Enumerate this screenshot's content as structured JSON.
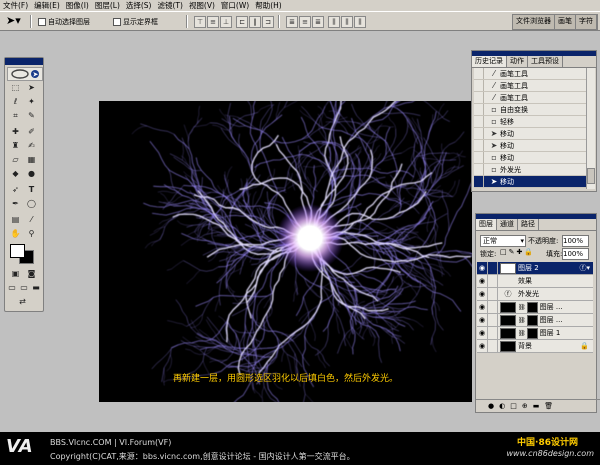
{
  "menu": [
    "文件(F)",
    "编辑(E)",
    "图像(I)",
    "图层(L)",
    "选择(S)",
    "滤镜(T)",
    "视图(V)",
    "窗口(W)",
    "帮助(H)"
  ],
  "options": {
    "auto_select": "自动选择图层",
    "show_bbox": "显示定界框"
  },
  "well_tabs": [
    "文件浏览器",
    "画笔",
    "字符"
  ],
  "history": {
    "tabs": [
      "历史记录",
      "动作",
      "工具预设"
    ],
    "items": [
      {
        "icon": "brush",
        "label": "画笔工具"
      },
      {
        "icon": "brush",
        "label": "画笔工具"
      },
      {
        "icon": "brush",
        "label": "画笔工具"
      },
      {
        "icon": "doc",
        "label": "自由变换"
      },
      {
        "icon": "doc",
        "label": "轻移"
      },
      {
        "icon": "move",
        "label": "移动"
      },
      {
        "icon": "move",
        "label": "移动"
      },
      {
        "icon": "doc",
        "label": "移动"
      },
      {
        "icon": "doc",
        "label": "外发光"
      },
      {
        "icon": "move",
        "label": "移动"
      }
    ]
  },
  "layers": {
    "tabs": [
      "图层",
      "通道",
      "路径"
    ],
    "blend_mode": "正常",
    "opacity_label": "不透明度:",
    "opacity": "100%",
    "lock_label": "锁定:",
    "fill_label": "填充:",
    "fill": "100%",
    "rows": [
      {
        "name": "图层 2",
        "type": "active"
      },
      {
        "name": "效果",
        "type": "effect-head"
      },
      {
        "name": "外发光",
        "type": "effect"
      },
      {
        "name": "图层 ...",
        "type": "masked"
      },
      {
        "name": "图层 ...",
        "type": "masked"
      },
      {
        "name": "图层 1",
        "type": "masked"
      },
      {
        "name": "背景",
        "type": "background"
      }
    ]
  },
  "canvas": {
    "caption": "再新建一层，用圆形选区羽化以后填白色，然后外发光。"
  },
  "footer": {
    "site": "BBS.VIcnc.COM",
    "forum": "VI.Forum(VF)",
    "copyright": "Copyright(C)CAT,来源：bbs.vicnc.com,创意设计论坛 - 国内设计人第一交流平台。",
    "logo_text": "VA",
    "brand": "中国·86设计网",
    "brand_url": "www.cn86design.com"
  },
  "colors": {
    "title_bar": "#0a246a",
    "chrome": "#d4d0c8",
    "caption": "#ffcc00",
    "brand": "#ffcc00"
  }
}
